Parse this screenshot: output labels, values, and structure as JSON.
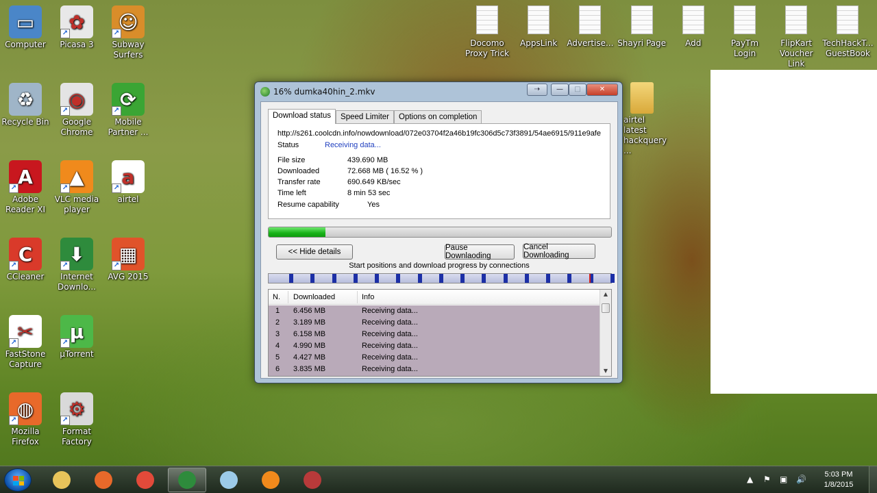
{
  "desktop": {
    "left_icons": [
      {
        "label": "Computer",
        "color": "#4a86c8",
        "glyph": "▭"
      },
      {
        "label": "Picasa 3",
        "color": "#e8e8e8",
        "glyph": "✿"
      },
      {
        "label": "Subway Surfers",
        "color": "#d98d2a",
        "glyph": "☺"
      },
      {
        "label": "Recycle Bin",
        "color": "#9fb5c8",
        "glyph": "♻"
      },
      {
        "label": "Google Chrome",
        "color": "#e4e4e4",
        "glyph": "◉"
      },
      {
        "label": "Mobile Partner ...",
        "color": "#3aa534",
        "glyph": "⟳"
      },
      {
        "label": "Adobe Reader XI",
        "color": "#c8171e",
        "glyph": "A"
      },
      {
        "label": "VLC media player",
        "color": "#f08a1c",
        "glyph": "▲"
      },
      {
        "label": "airtel",
        "color": "#ffffff",
        "glyph": "a"
      },
      {
        "label": "CCleaner",
        "color": "#d93a2a",
        "glyph": "C"
      },
      {
        "label": "Internet Downlo...",
        "color": "#2e8b3c",
        "glyph": "⬇"
      },
      {
        "label": "AVG 2015",
        "color": "#e0532a",
        "glyph": "▦"
      },
      {
        "label": "FastStone Capture",
        "color": "#ffffff",
        "glyph": "✂"
      },
      {
        "label": "µTorrent",
        "color": "#4db848",
        "glyph": "µ"
      },
      {
        "label": "Mozilla Firefox",
        "color": "#e8692a",
        "glyph": "◍"
      },
      {
        "label": "Format Factory",
        "color": "#d9d9d9",
        "glyph": "⚙"
      }
    ],
    "top_icons": [
      {
        "label": "Docomo Proxy Trick"
      },
      {
        "label": "AppsLink"
      },
      {
        "label": "Advertise..."
      },
      {
        "label": "Shayri Page"
      },
      {
        "label": "Add"
      },
      {
        "label": "PayTm Login"
      },
      {
        "label": "FlipKart Voucher Link"
      },
      {
        "label": "TechHackT... GuestBook"
      }
    ],
    "folder_icon": {
      "label": "airtel latest hackquery ..."
    }
  },
  "window": {
    "title": "16% dumka40hin_2.mkv",
    "title_buttons": [
      "⇢",
      "—",
      "□",
      "✕"
    ],
    "tabs": [
      "Download status",
      "Speed Limiter",
      "Options on completion"
    ],
    "url": "http://s261.coolcdn.info/nowdownload/072e03704f2a46b19fc306d5c73f3891/54ae6915/911e9afe",
    "status_label": "Status",
    "status_value": "Receiving data...",
    "fields": [
      {
        "label": "File size",
        "value": "439.690  MB"
      },
      {
        "label": "Downloaded",
        "value": "72.668  MB  ( 16.52 % )"
      },
      {
        "label": "Transfer rate",
        "value": "690.649  KB/sec"
      },
      {
        "label": "Time left",
        "value": "8 min 53 sec"
      },
      {
        "label": "Resume capability",
        "value": "Yes"
      }
    ],
    "progress": 0.1652,
    "buttons": {
      "hide_details": "<< Hide details",
      "pause": "Pause Downlaoding",
      "cancel": "Cancel Downloading"
    },
    "connections_label": "Start positions and download progress by connections",
    "connection_count": 16,
    "list_headers": [
      "N.",
      "Downloaded",
      "Info"
    ],
    "connections": [
      {
        "n": "1",
        "downloaded": "6.456  MB",
        "info": "Receiving data..."
      },
      {
        "n": "2",
        "downloaded": "3.189  MB",
        "info": "Receiving data..."
      },
      {
        "n": "3",
        "downloaded": "6.158  MB",
        "info": "Receiving data..."
      },
      {
        "n": "4",
        "downloaded": "4.990  MB",
        "info": "Receiving data..."
      },
      {
        "n": "5",
        "downloaded": "4.427  MB",
        "info": "Receiving data..."
      },
      {
        "n": "6",
        "downloaded": "3.835  MB",
        "info": "Receiving data..."
      }
    ]
  },
  "taskbar": {
    "items": [
      {
        "name": "explorer",
        "color": "#e8c45a"
      },
      {
        "name": "firefox",
        "color": "#e8692a"
      },
      {
        "name": "chrome",
        "color": "#e24a3a"
      },
      {
        "name": "internet-download-manager",
        "color": "#2e8b3c"
      },
      {
        "name": "notepad",
        "color": "#9ccbe8"
      },
      {
        "name": "vlc",
        "color": "#f08a1c"
      },
      {
        "name": "snipping-tool",
        "color": "#b83a3a"
      }
    ],
    "active_index": 3,
    "time": "5:03 PM",
    "date": "1/8/2015",
    "tray_icons": [
      "▲",
      "⚑",
      "▣",
      "🔊"
    ]
  }
}
